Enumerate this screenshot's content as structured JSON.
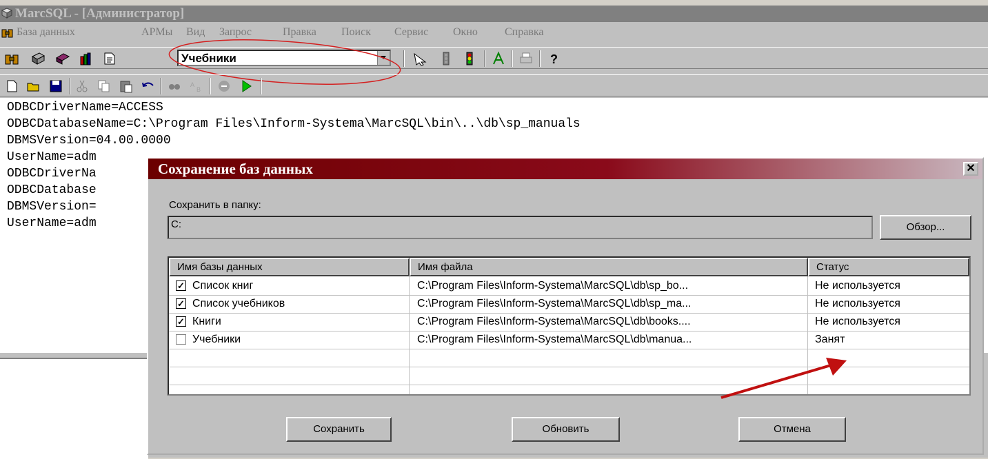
{
  "app": {
    "title": "MarcSQL - [Администратор]",
    "accent": "#808080"
  },
  "menu": [
    "База данных",
    "АРМы",
    "Вид",
    "Запрос",
    "Правка",
    "Поиск",
    "Сервис",
    "Окно",
    "Справка"
  ],
  "toolbar": {
    "database_select": "Учебники",
    "highlight_color": "#d42020"
  },
  "editor": {
    "lines": [
      "ODBCDriverName=ACCESS",
      "ODBCDatabaseName=C:\\Program Files\\Inform-Systema\\MarcSQL\\bin\\..\\db\\sp_manuals",
      "DBMSVersion=04.00.0000",
      "UserName=adm",
      "ODBCDriverNa",
      "ODBCDatabase",
      "DBMSVersion=",
      "UserName=adm"
    ]
  },
  "dialog": {
    "title": "Сохранение баз данных",
    "close_glyph": "✕",
    "folder_label": "Сохранить в папку:",
    "folder_value": "C:",
    "browse_label": "Обзор...",
    "columns": [
      "Имя базы данных",
      "Имя файла",
      "Статус"
    ],
    "rows": [
      {
        "checked": true,
        "name": "Список книг",
        "file": "C:\\Program Files\\Inform-Systema\\MarcSQL\\db\\sp_bo...",
        "status": "Не используется"
      },
      {
        "checked": true,
        "name": "Список учебников",
        "file": "C:\\Program Files\\Inform-Systema\\MarcSQL\\db\\sp_ma...",
        "status": "Не используется"
      },
      {
        "checked": true,
        "name": "Книги",
        "file": "C:\\Program Files\\Inform-Systema\\MarcSQL\\db\\books....",
        "status": "Не используется"
      },
      {
        "checked": false,
        "name": "Учебники",
        "file": "C:\\Program Files\\Inform-Systema\\MarcSQL\\db\\manua...",
        "status": "Занят"
      }
    ],
    "save_label": "Сохранить",
    "refresh_label": "Обновить",
    "cancel_label": "Отмена",
    "title_color": "#6b0000"
  },
  "icons": {
    "toolbar1": [
      "databases-icon",
      "table-icon",
      "binoculars-icon",
      "books-icon",
      "document-icon"
    ],
    "toolbar1b": [
      "pointer-icon",
      "traffic-light-gray-icon",
      "traffic-light-icon",
      "font-icon",
      "print-icon",
      "help-icon"
    ],
    "toolbar2": [
      "new-icon",
      "open-icon",
      "save-icon",
      "cut-icon",
      "copy-icon",
      "paste-icon",
      "undo-icon",
      "find-icon",
      "replace-icon",
      "stop-icon",
      "run-icon"
    ]
  }
}
